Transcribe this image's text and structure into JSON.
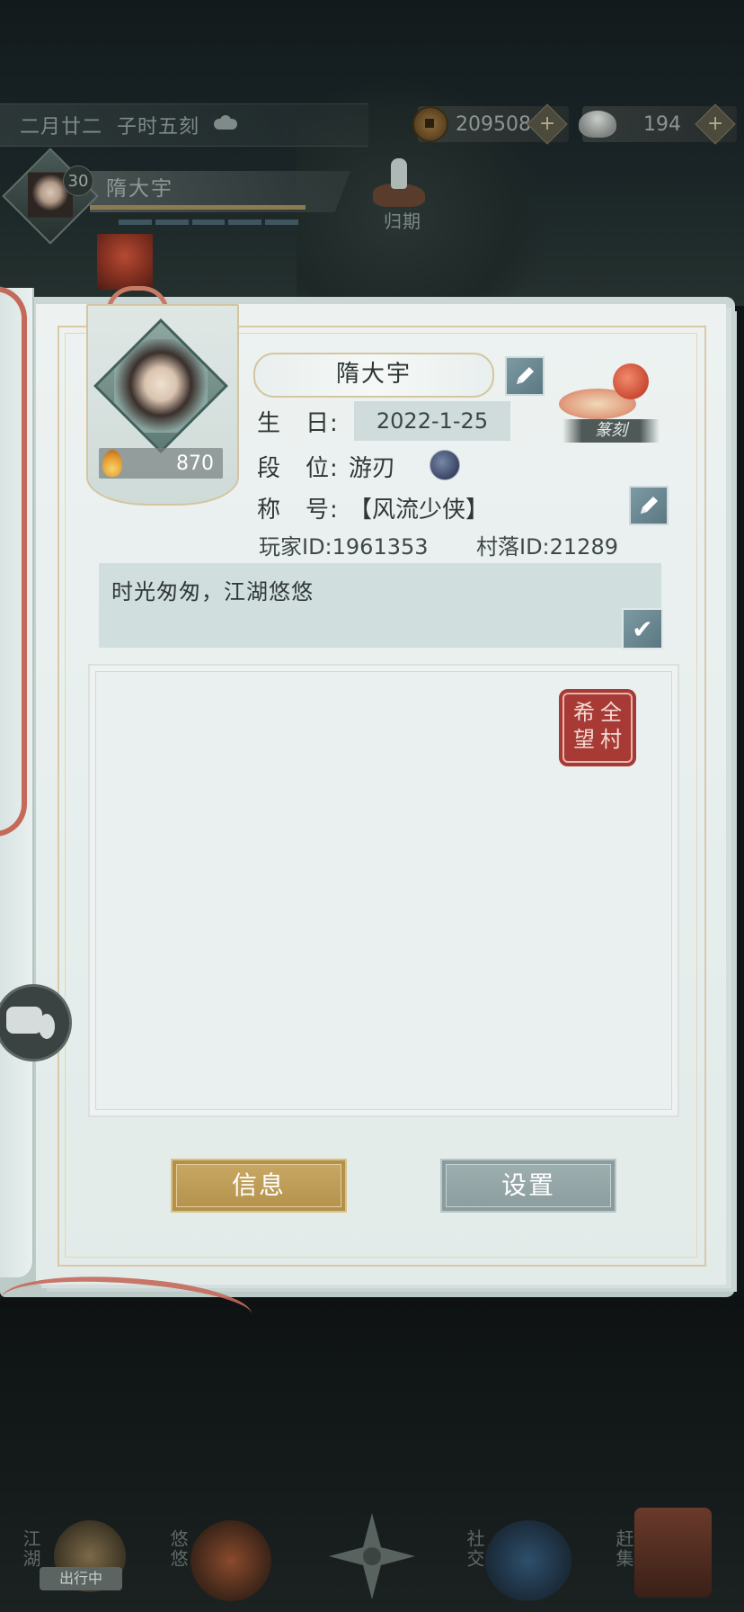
{
  "topbar": {
    "date": "二月廿二",
    "time": "子时五刻",
    "weather_icon": "cloud-icon"
  },
  "currencies": [
    {
      "icon": "copper-coin-icon",
      "value": "209508",
      "add": "+"
    },
    {
      "icon": "silver-ingot-icon",
      "value": "194",
      "add": "+"
    }
  ],
  "player": {
    "name": "隋大宇",
    "level": "30"
  },
  "travel": {
    "label": "归期"
  },
  "profile": {
    "name": "隋大宇",
    "fire_value": "870",
    "birthday_label": "生　日:",
    "birthday": "2022-1-25",
    "rank_label": "段　位:",
    "rank": "游刃",
    "title_label": "称　号:",
    "title": "【风流少侠】",
    "player_id": "玩家ID:1961353",
    "village_id": "村落ID:21289",
    "signature": "时光匆匆，江湖悠悠",
    "seal_carving_label": "篆刻",
    "red_seal_chars": [
      "全",
      "村",
      "希",
      "望"
    ]
  },
  "tabs": {
    "info": "信息",
    "settings": "设置"
  },
  "bottom_nav": {
    "jianghu": "江湖",
    "youyou": "悠悠",
    "shejiao": "社交",
    "ganji": "赶集",
    "status": "出行中"
  }
}
